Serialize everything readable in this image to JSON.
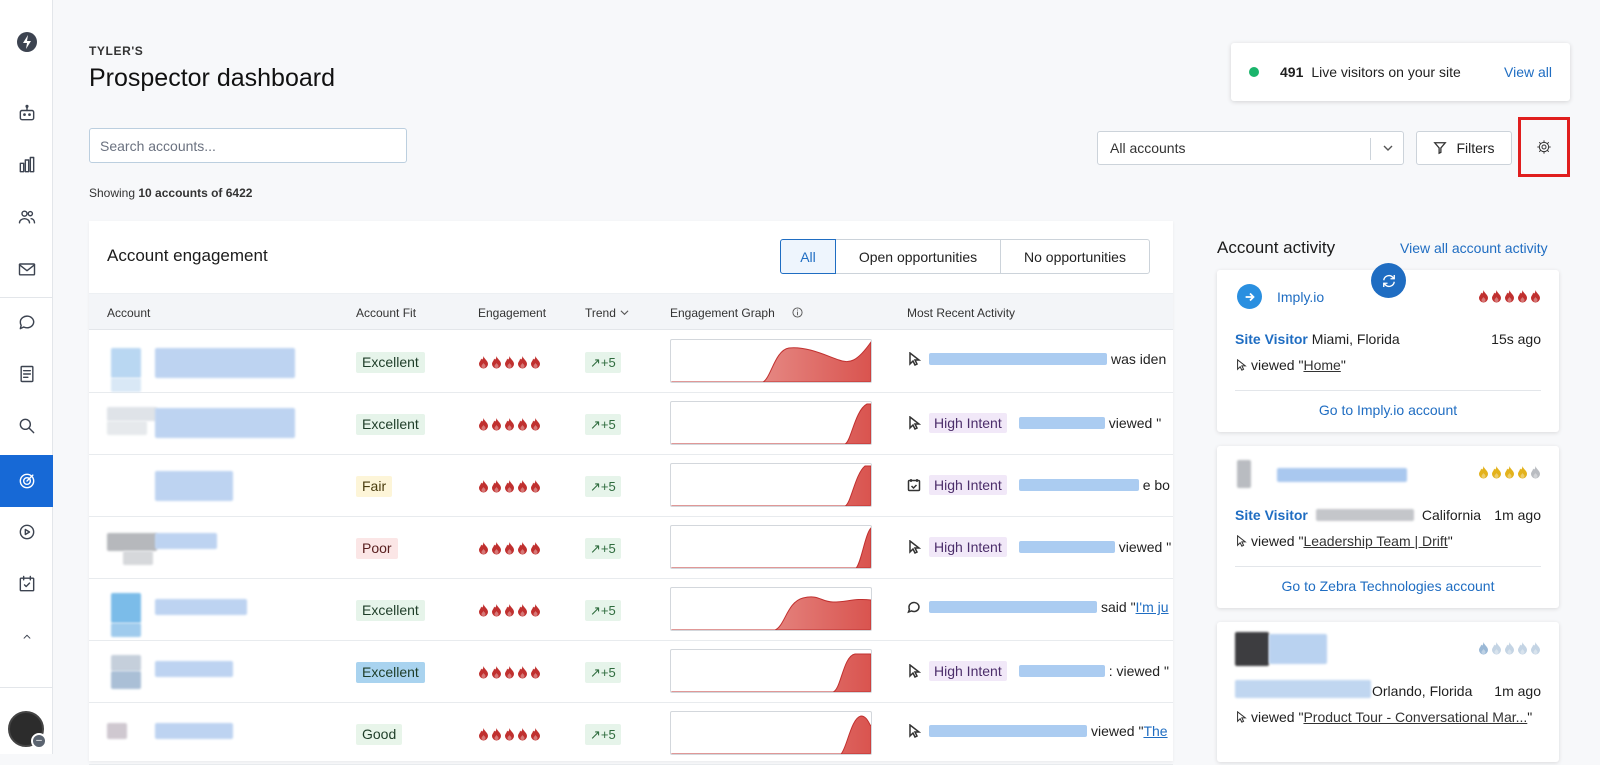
{
  "header": {
    "eyebrow": "TYLER'S",
    "title": "Prospector dashboard"
  },
  "search": {
    "placeholder": "Search accounts..."
  },
  "showing": {
    "prefix": "Showing",
    "count": "10 accounts of 6422"
  },
  "live": {
    "count": "491",
    "text": "Live visitors on your site",
    "link": "View all"
  },
  "account_select": {
    "value": "All accounts"
  },
  "filters": {
    "label": "Filters"
  },
  "engagement": {
    "title": "Account engagement",
    "segments": [
      "All",
      "Open opportunities",
      "No opportunities"
    ],
    "columns": [
      "Account",
      "Account Fit",
      "Engagement",
      "Trend",
      "Engagement Graph",
      "Most Recent Activity"
    ],
    "rows": [
      {
        "fit": "Excellent",
        "trend": "↗+5",
        "activity": {
          "icon": "pointer-icon",
          "text": "was iden"
        }
      },
      {
        "fit": "Excellent",
        "trend": "↗+5",
        "activity": {
          "icon": "pointer-icon",
          "badge": "High Intent",
          "text": "viewed \""
        }
      },
      {
        "fit": "Fair",
        "trend": "↗+5",
        "activity": {
          "icon": "calendar-icon",
          "badge": "High Intent",
          "text": "e bo"
        }
      },
      {
        "fit": "Poor",
        "trend": "↗+5",
        "activity": {
          "icon": "pointer-icon",
          "badge": "High Intent",
          "text": "viewed \""
        }
      },
      {
        "fit": "Excellent",
        "trend": "↗+5",
        "activity": {
          "icon": "chat-icon",
          "text": "said \"",
          "link": "I'm ju"
        }
      },
      {
        "fit": "Excellent",
        "trend": "↗+5",
        "activity": {
          "icon": "pointer-icon",
          "badge": "High Intent",
          "text": ": viewed \""
        }
      },
      {
        "fit": "Good",
        "trend": "↗+5",
        "activity": {
          "icon": "pointer-icon",
          "text": "viewed \"",
          "link": "The"
        }
      }
    ]
  },
  "activity": {
    "title": "Account activity",
    "link": "View all account activity",
    "cards": [
      {
        "name": "Imply.io",
        "visitor": "Site Visitor",
        "location": "Miami, Florida",
        "time": "15s ago",
        "viewed": "viewed \"",
        "page": "Home",
        "go": "Go to Imply.io account"
      },
      {
        "visitor": "Site Visitor",
        "location": "California",
        "time": "1m ago",
        "viewed": "viewed \"",
        "page": "Leadership Team | Drift",
        "go": "Go to Zebra Technologies account"
      },
      {
        "location": "Orlando, Florida",
        "time": "1m ago",
        "viewed": "viewed \"",
        "page": "Product Tour - Conversational Mar..."
      }
    ]
  },
  "colors": {
    "accent": "#1f6dc2",
    "flame": "#c0302f",
    "flame_yellow": "#e3b21c",
    "flame_blue": "#9ab8d6",
    "highlight": "#e01e1e"
  }
}
